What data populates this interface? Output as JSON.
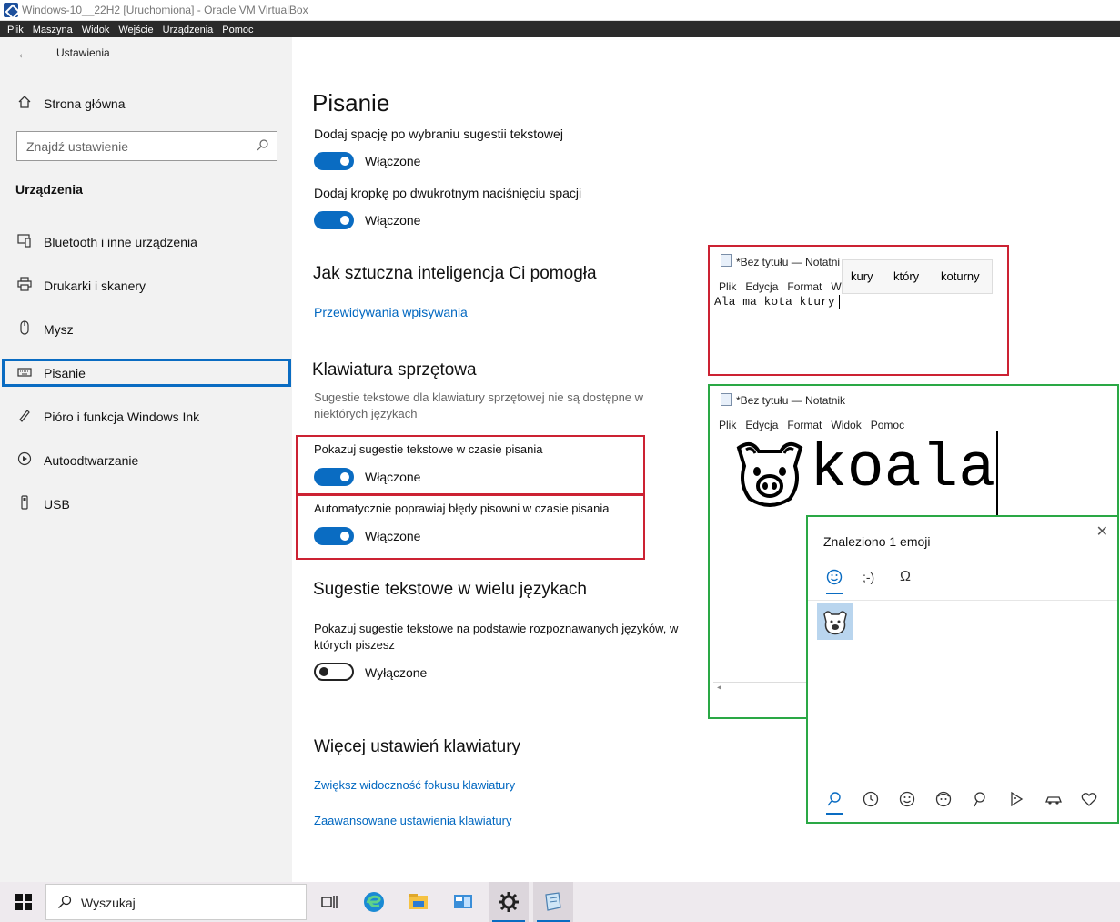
{
  "vbox": {
    "title": "Windows-10__22H2 [Uruchomiona] - Oracle VM VirtualBox",
    "menu": [
      "Plik",
      "Maszyna",
      "Widok",
      "Wejście",
      "Urządzenia",
      "Pomoc"
    ]
  },
  "sidebar": {
    "app_title": "Ustawienia",
    "home": "Strona główna",
    "search_placeholder": "Znajdź ustawienie",
    "section": "Urządzenia",
    "items": [
      {
        "label": "Bluetooth i inne urządzenia",
        "icon": "bluetooth-devices-icon"
      },
      {
        "label": "Drukarki i skanery",
        "icon": "printer-icon"
      },
      {
        "label": "Mysz",
        "icon": "mouse-icon"
      },
      {
        "label": "Pisanie",
        "icon": "keyboard-icon",
        "selected": true
      },
      {
        "label": "Pióro i funkcja Windows Ink",
        "icon": "pen-icon"
      },
      {
        "label": "Autoodtwarzanie",
        "icon": "autoplay-icon"
      },
      {
        "label": "USB",
        "icon": "usb-icon"
      }
    ]
  },
  "main": {
    "page_title": "Pisanie",
    "opt_space": {
      "label": "Dodaj spację po wybraniu sugestii tekstowej",
      "state": "Włączone"
    },
    "opt_period": {
      "label": "Dodaj kropkę po dwukrotnym naciśnięciu spacji",
      "state": "Włączone"
    },
    "ai_heading": "Jak sztuczna inteligencja Ci pomogła",
    "ai_link": "Przewidywania wpisywania",
    "hw_heading": "Klawiatura sprzętowa",
    "hw_note": [
      "Sugestie tekstowe dla klawiatury sprzętowej nie są dostępne w",
      "niektórych językach"
    ],
    "opt_show_suggest": {
      "label": "Pokazuj sugestie tekstowe w czasie pisania",
      "state": "Włączone"
    },
    "opt_autocorrect": {
      "label": "Automatycznie poprawiaj błędy pisowni w czasie pisania",
      "state": "Włączone"
    },
    "multi_heading": "Sugestie tekstowe w wielu językach",
    "opt_multi": {
      "label": [
        "Pokazuj sugestie tekstowe na podstawie rozpoznawanych języków, w",
        "których piszesz"
      ],
      "state": "Wyłączone"
    },
    "more_heading": "Więcej ustawień klawiatury",
    "link_focus": "Zwiększ widoczność fokusu klawiatury",
    "link_advanced": "Zaawansowane ustawienia klawiatury"
  },
  "notepad1": {
    "title": "*Bez tytułu — Notatni",
    "menu": [
      "Plik",
      "Edycja",
      "Format",
      "W"
    ],
    "text": "Ala ma kota ktury",
    "suggestions": [
      "kury",
      "który",
      "koturny"
    ]
  },
  "notepad2": {
    "title": "*Bez tytułu — Notatnik",
    "menu": [
      "Plik",
      "Edycja",
      "Format",
      "Widok",
      "Pomoc"
    ],
    "text": "koala"
  },
  "emoji_panel": {
    "header": "Znaleziono 1 emoji",
    "tabs": [
      "emoji-tab-icon",
      ";-)",
      "symbols-tab-icon"
    ],
    "kaomoji": ";-)"
  },
  "taskbar": {
    "search": "Wyszukaj"
  },
  "colors": {
    "accent": "#0a6cc2",
    "link": "#0067c0",
    "highlight_red": "#cc2233",
    "highlight_green": "#2aa845",
    "highlight_blue": "#0a6cc2"
  }
}
